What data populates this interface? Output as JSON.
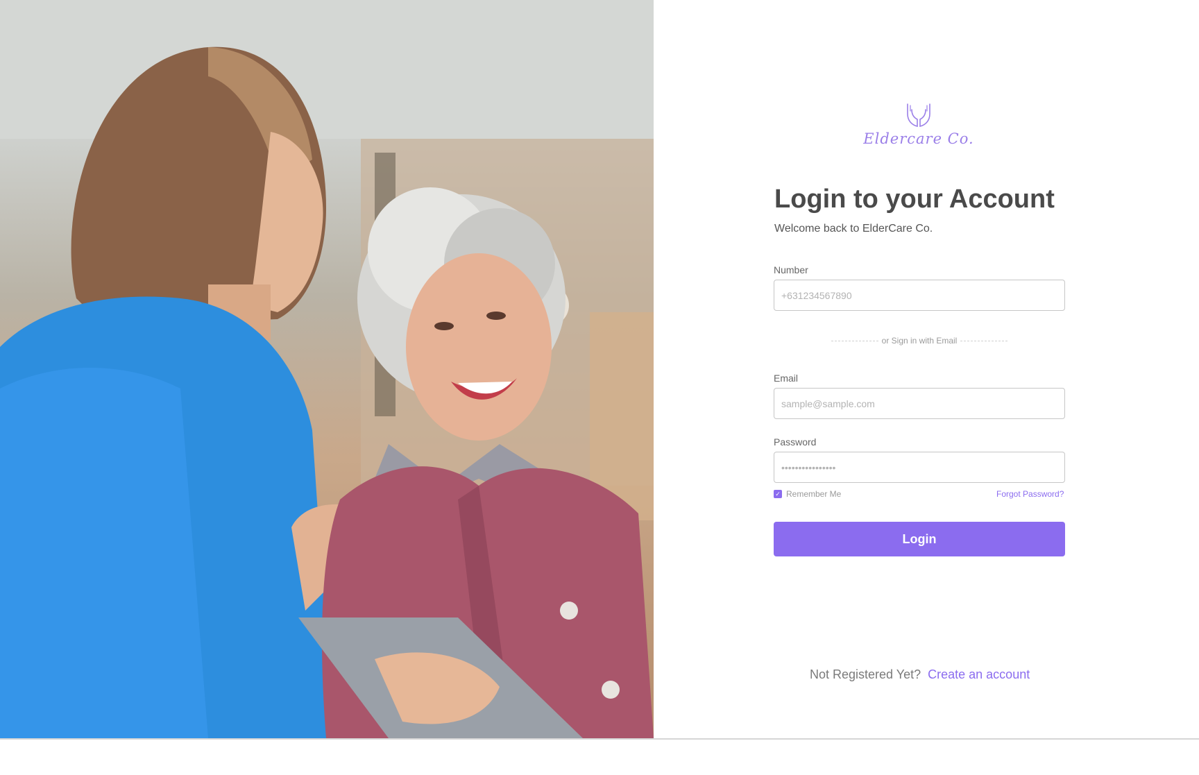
{
  "brand": {
    "logo_text": "Eldercare Co.",
    "logo_icon": "hands-holding-icon",
    "accent_color": "#8b6cef"
  },
  "photo": {
    "icon": "caregiver-with-elderly-woman-photo"
  },
  "form": {
    "title": "Login to your Account",
    "subtitle": "Welcome back to ElderCare Co.",
    "number": {
      "label": "Number",
      "placeholder": "+631234567890",
      "value": ""
    },
    "divider_text": "or Sign in with Email",
    "email": {
      "label": "Email",
      "placeholder": "sample@sample.com",
      "value": ""
    },
    "password": {
      "label": "Password",
      "placeholder": "••••••••••••••••",
      "value": ""
    },
    "remember_me": {
      "label": "Remember Me",
      "checked": true
    },
    "forgot_password": "Forgot Password?",
    "login_button": "Login"
  },
  "footer": {
    "not_registered": "Not Registered Yet?",
    "create_account": "Create an account"
  }
}
